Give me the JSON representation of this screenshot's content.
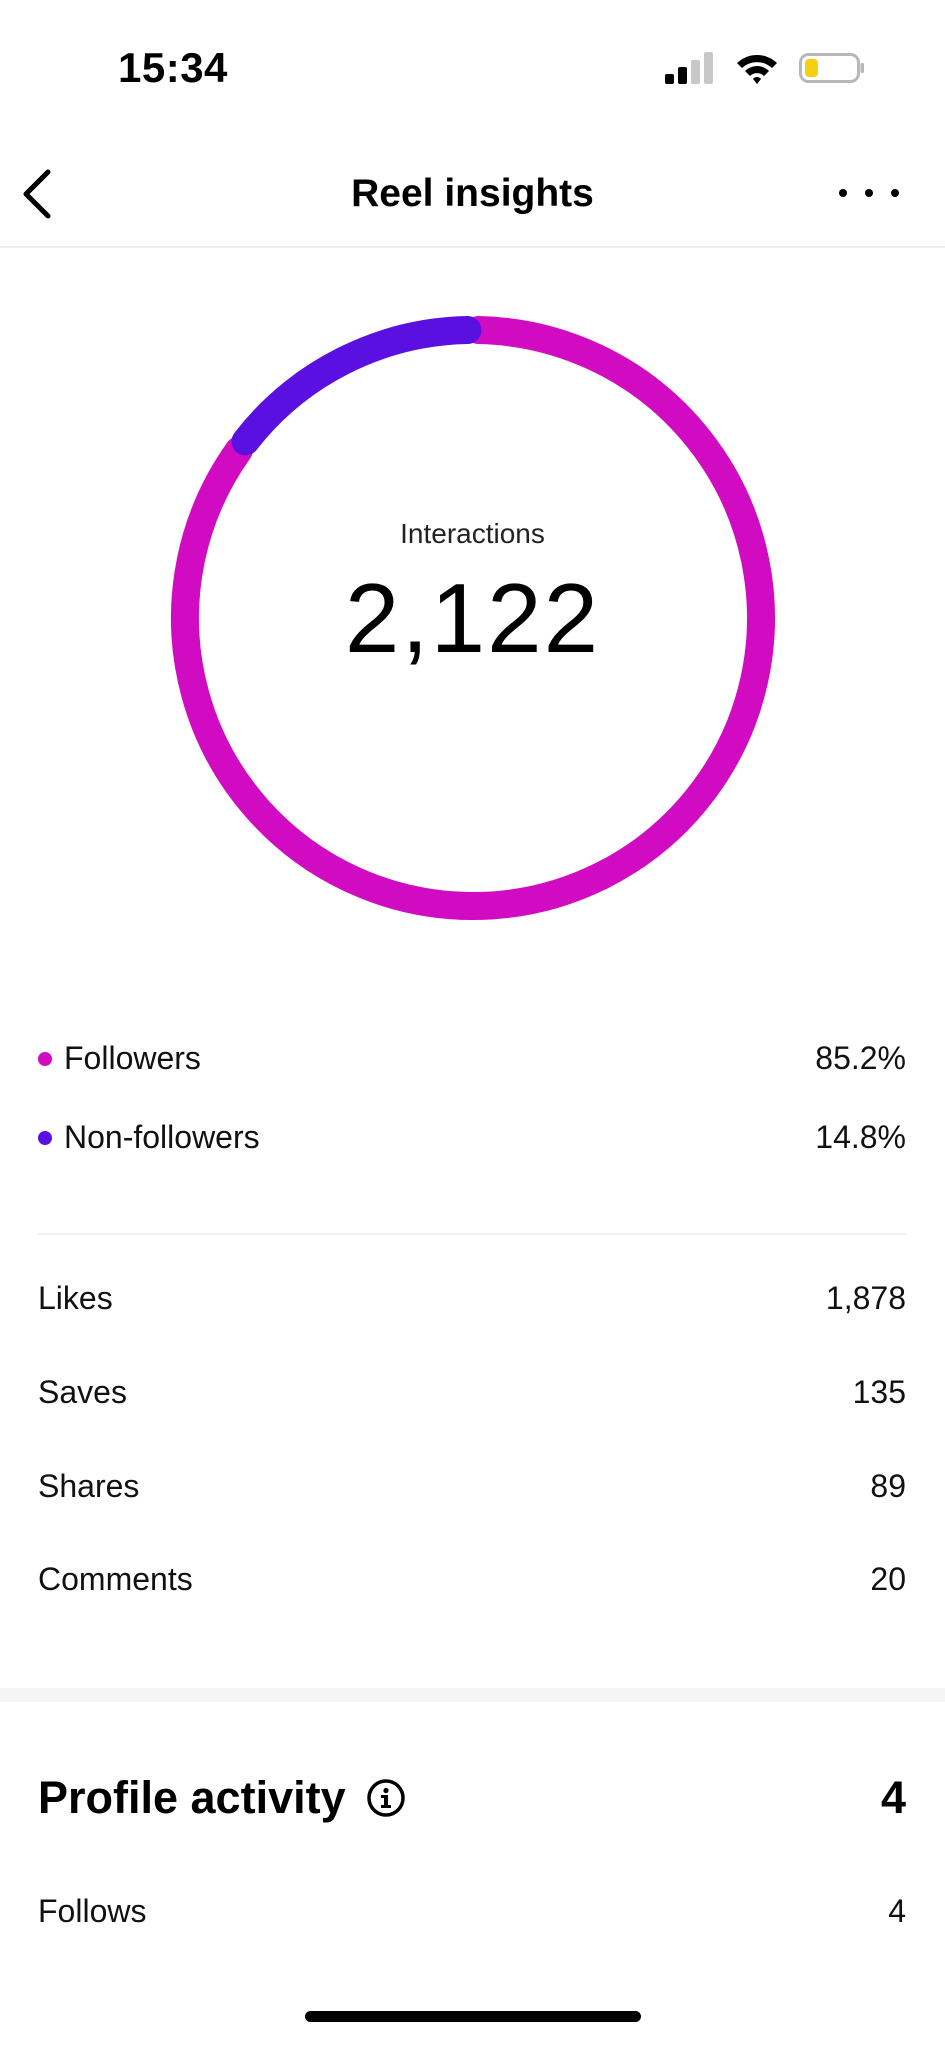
{
  "status_bar": {
    "time": "15:34"
  },
  "header": {
    "title": "Reel insights"
  },
  "interactions": {
    "label": "Interactions",
    "total": "2,122"
  },
  "chart_data": {
    "type": "pie",
    "categories": [
      "Followers",
      "Non-followers"
    ],
    "values": [
      85.2,
      14.8
    ],
    "colors": [
      "#d10bc2",
      "#5a10e0"
    ],
    "center_label": "Interactions",
    "center_value": "2,122"
  },
  "audience": [
    {
      "label": "Followers",
      "value": "85.2%",
      "color": "#d10bc2"
    },
    {
      "label": "Non-followers",
      "value": "14.8%",
      "color": "#5a10e0"
    }
  ],
  "metrics": [
    {
      "label": "Likes",
      "value": "1,878"
    },
    {
      "label": "Saves",
      "value": "135"
    },
    {
      "label": "Shares",
      "value": "89"
    },
    {
      "label": "Comments",
      "value": "20"
    }
  ],
  "profile_activity": {
    "title": "Profile activity",
    "total": "4",
    "items": [
      {
        "label": "Follows",
        "value": "4"
      }
    ]
  }
}
